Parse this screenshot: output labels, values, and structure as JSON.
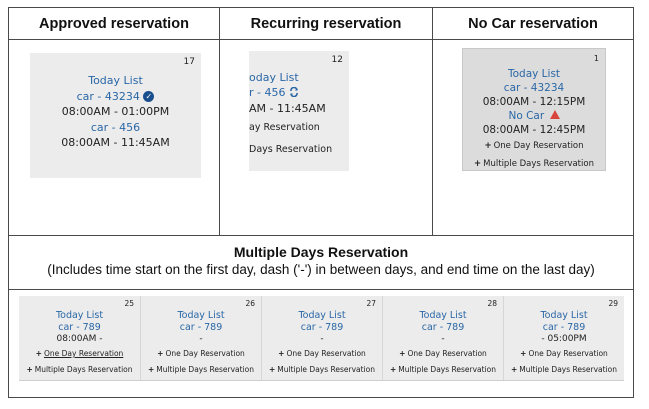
{
  "headers": {
    "approved": "Approved reservation",
    "recurring": "Recurring reservation",
    "no_car": "No Car reservation"
  },
  "approved_cell": {
    "day": "17",
    "title": "Today List",
    "car1": "car - 43234",
    "time1": "08:00AM - 01:00PM",
    "car2": "car - 456",
    "time2": "08:00AM - 11:45AM"
  },
  "recurring_cell": {
    "day": "12",
    "title": "oday List",
    "car": "r - 456",
    "time": "AM - 11:45AM",
    "one_day": "ay Reservation",
    "multi": "Days Reservation"
  },
  "no_car_cell": {
    "day": "1",
    "title": "Today List",
    "car": "car - 43234",
    "time1": "08:00AM - 12:15PM",
    "no_car": "No Car",
    "time2": "08:00AM - 12:45PM",
    "one_day": "One Day Reservation",
    "multi": "Multiple Days Reservation"
  },
  "multi_section": {
    "title": "Multiple Days Reservation",
    "subtitle": "(Includes time start on the first day, dash ('-') in between days, and end time on the last day)"
  },
  "multi_days": [
    {
      "day": "25",
      "title": "Today List",
      "car": "car - 789",
      "time": "08:00AM -",
      "one_day": "One Day Reservation",
      "multi": "Multiple Days Reservation"
    },
    {
      "day": "26",
      "title": "Today List",
      "car": "car - 789",
      "time": "-",
      "one_day": "One Day Reservation",
      "multi": "Multiple Days Reservation"
    },
    {
      "day": "27",
      "title": "Today List",
      "car": "car - 789",
      "time": "-",
      "one_day": "One Day Reservation",
      "multi": "Multiple Days Reservation"
    },
    {
      "day": "28",
      "title": "Today List",
      "car": "car - 789",
      "time": "-",
      "one_day": "One Day Reservation",
      "multi": "Multiple Days Reservation"
    },
    {
      "day": "29",
      "title": "Today List",
      "car": "car - 789",
      "time": "- 05:00PM",
      "one_day": "One Day Reservation",
      "multi": "Multiple Days Reservation"
    }
  ],
  "colors": {
    "link_blue": "#2a67a6",
    "cell_bg": "#ececec",
    "warning_red": "#d9443b",
    "check_blue": "#1a4f8e"
  },
  "icons": {
    "approved": "check-circle-icon",
    "recurring": "repeat-icon",
    "no_car": "warning-icon",
    "add": "plus-icon"
  }
}
